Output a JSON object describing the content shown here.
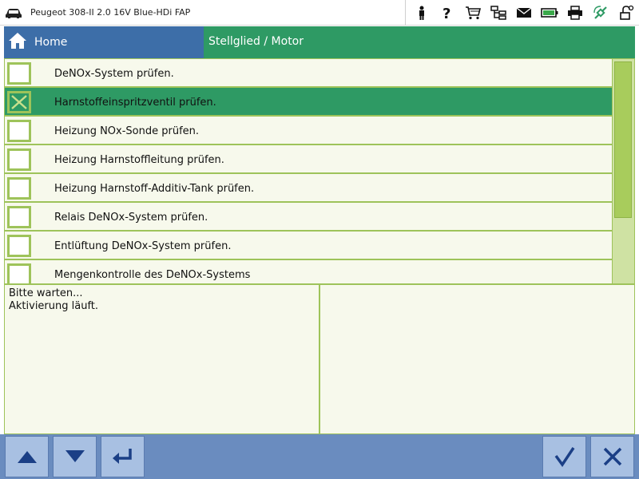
{
  "vehicle": {
    "title": "Peugeot 308-II 2.0 16V Blue-HDi FAP"
  },
  "top_icons": [
    "person-icon",
    "help-icon",
    "cart-icon",
    "network-icon",
    "mail-icon",
    "battery-icon",
    "printer-icon",
    "connection-icon",
    "lock-icon"
  ],
  "breadcrumb": {
    "home": "Home",
    "current": "Stellglied / Motor"
  },
  "list": {
    "items": [
      {
        "label": "DeNOx-System prüfen.",
        "checked": false
      },
      {
        "label": "Harnstoffeinspritzventil prüfen.",
        "checked": true
      },
      {
        "label": "Heizung NOx-Sonde prüfen.",
        "checked": false
      },
      {
        "label": "Heizung Harnstoffleitung prüfen.",
        "checked": false
      },
      {
        "label": "Heizung Harnstoff-Additiv-Tank prüfen.",
        "checked": false
      },
      {
        "label": "Relais DeNOx-System prüfen.",
        "checked": false
      },
      {
        "label": "Entlüftung DeNOx-System prüfen.",
        "checked": false
      },
      {
        "label": "Mengenkontrolle des DeNOx-Systems",
        "checked": false
      }
    ]
  },
  "messages": {
    "line1": "Bitte warten...",
    "line2": "Aktivierung läuft."
  },
  "toolbar": {
    "buttons": [
      "up-arrow",
      "down-arrow",
      "enter",
      "confirm",
      "cancel"
    ]
  },
  "colors": {
    "green": "#2e9a64",
    "blue": "#3d6ea8",
    "toolbar": "#6a8cbf",
    "lime": "#9ec35a"
  }
}
